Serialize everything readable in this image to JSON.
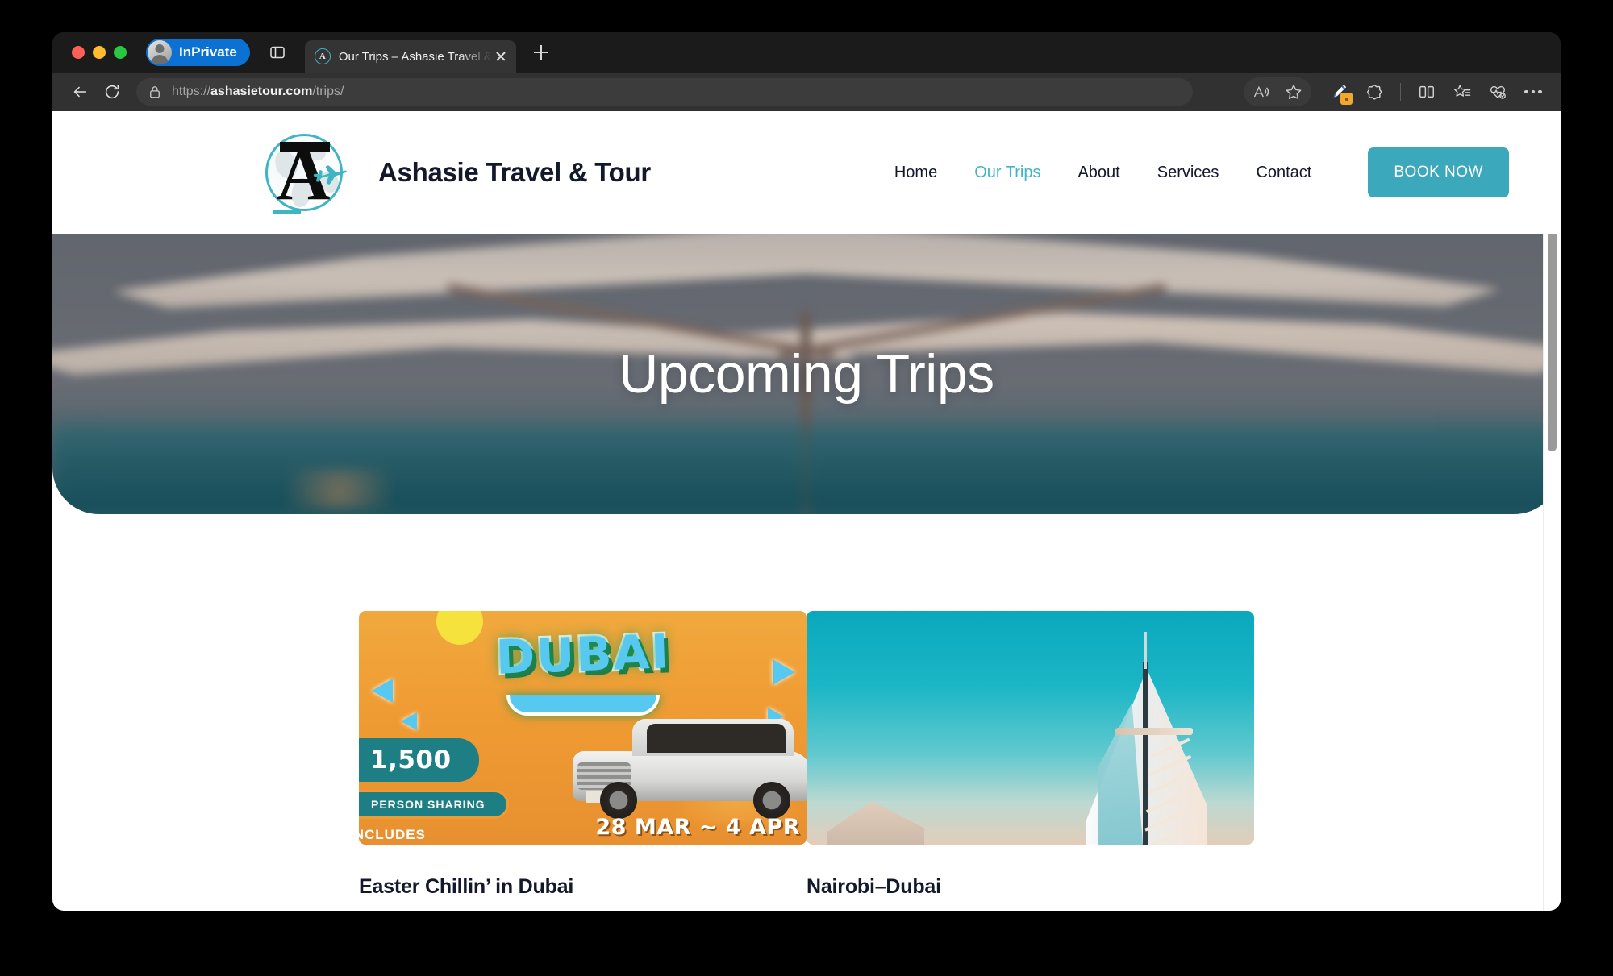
{
  "browser": {
    "profile_badge": "InPrivate",
    "tab": {
      "title": "Our Trips – Ashasie Travel & To",
      "favicon_letter": "A",
      "close_label": "Close tab"
    },
    "new_tab_label": "New tab",
    "tab_list_label": "Tab actions menu",
    "back_label": "Back",
    "refresh_label": "Refresh",
    "url": {
      "scheme": "https://",
      "domain": "ashasietour.com",
      "path": "/trips/",
      "full": "https://ashasietour.com/trips/"
    },
    "toolbar": {
      "read_aloud": "Read aloud",
      "add_favorite": "Add this page to favorites",
      "highlighter": "Highlighter",
      "highlighter_badge": "1",
      "copilot": "Copilot",
      "split_screen": "Split screen",
      "collections": "Collections",
      "browser_essentials": "Browser essentials",
      "settings_more": "Settings and more"
    },
    "scrollbar_label": "Page scrollbar"
  },
  "site": {
    "brand": {
      "name": "Ashasie Travel & Tour",
      "logo_letter": "A"
    },
    "nav": [
      {
        "label": "Home",
        "active": false
      },
      {
        "label": "Our Trips",
        "active": true
      },
      {
        "label": "About",
        "active": false
      },
      {
        "label": "Services",
        "active": false
      },
      {
        "label": "Contact",
        "active": false
      }
    ],
    "cta": {
      "label": "BOOK NOW"
    },
    "hero": {
      "title": "Upcoming Trips"
    },
    "trips": [
      {
        "title": "Easter Chillin’ in Dubai",
        "poster": {
          "headline": "DUBAI",
          "price": "1,500",
          "price_note": "PERSON SHARING",
          "includes": "INCLUDES",
          "dates": "28 MAR ~ 4 APR"
        }
      },
      {
        "title": "Nairobi–Dubai",
        "poster": {}
      }
    ]
  },
  "colors": {
    "accent_teal": "#3CA8BC",
    "nav_active": "#3FB5C4",
    "text_dark": "#13182B",
    "inprivate_blue": "#0B72D4",
    "poster_orange": "#EF9B33",
    "poster_badge_teal": "#1D7F83"
  }
}
